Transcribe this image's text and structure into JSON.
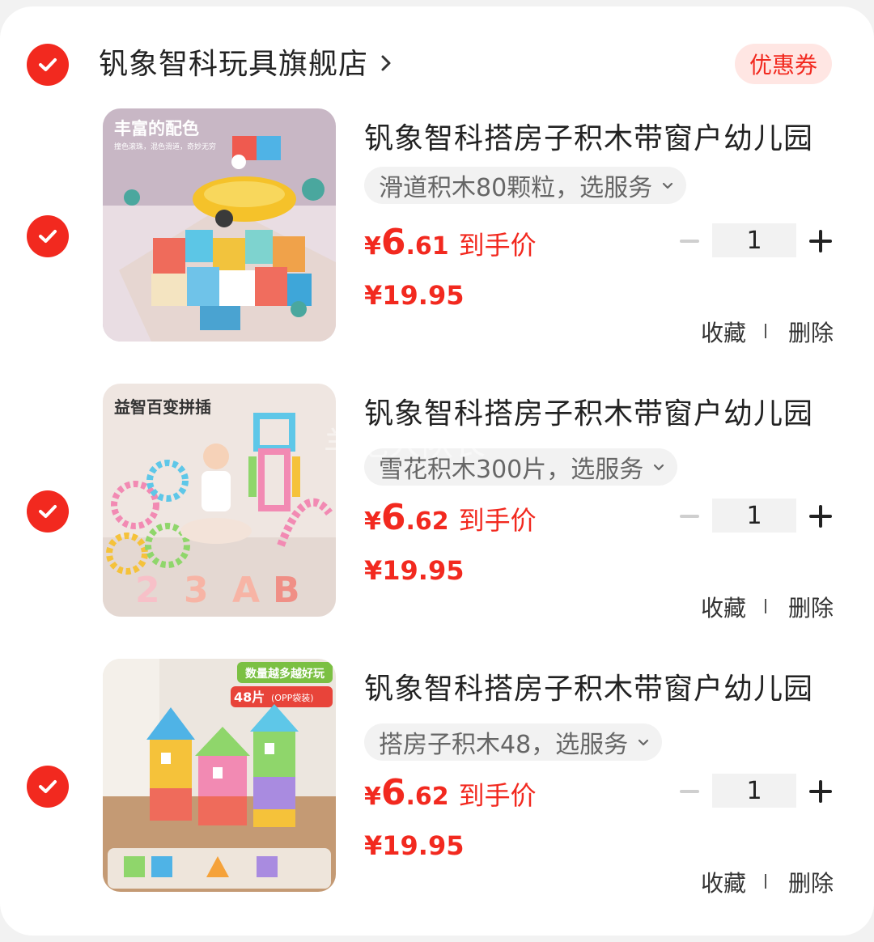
{
  "shop": {
    "name": "钒象智科玩具旗舰店",
    "coupon_label": "优惠券"
  },
  "items": [
    {
      "title": "钒象智科搭房子积木带窗户幼儿园",
      "sku": "滑道积木80颗粒，选服务",
      "deal_currency": "¥",
      "deal_int": "6",
      "deal_dec": ".61",
      "deal_label": "到手价",
      "original_price": "¥19.95",
      "quantity": "1",
      "fav_label": "收藏",
      "delete_label": "删除",
      "image_caption": "丰富的配色",
      "image_subcaption": "撞色滚珠，混色滑道，奇妙无穷"
    },
    {
      "title": "钒象智科搭房子积木带窗户幼儿园",
      "sku": "雪花积木300片，选服务",
      "deal_currency": "¥",
      "deal_int": "6",
      "deal_dec": ".62",
      "deal_label": "到手价",
      "original_price": "¥19.95",
      "quantity": "1",
      "fav_label": "收藏",
      "delete_label": "删除",
      "image_caption": "益智百变拼插"
    },
    {
      "title": "钒象智科搭房子积木带窗户幼儿园",
      "sku": "搭房子积木48，选服务",
      "deal_currency": "¥",
      "deal_int": "6",
      "deal_dec": ".62",
      "deal_label": "到手价",
      "original_price": "¥19.95",
      "quantity": "1",
      "fav_label": "收藏",
      "delete_label": "删除",
      "image_caption": "数量越多越好玩",
      "image_badge": "48片",
      "image_badge_note": "(OPP袋装)"
    }
  ],
  "watermark": "羊毛大队长",
  "colors": {
    "accent": "#f2291f",
    "coupon_bg": "#ffe6e3",
    "sku_bg": "#f2f2f2",
    "page_bg": "#f2f2f2"
  },
  "icons": {
    "check": "check-circle-icon",
    "arrow": "chevron-right-icon",
    "sku_dropdown": "chevron-down-icon",
    "minus": "minus-icon",
    "plus": "plus-icon"
  }
}
